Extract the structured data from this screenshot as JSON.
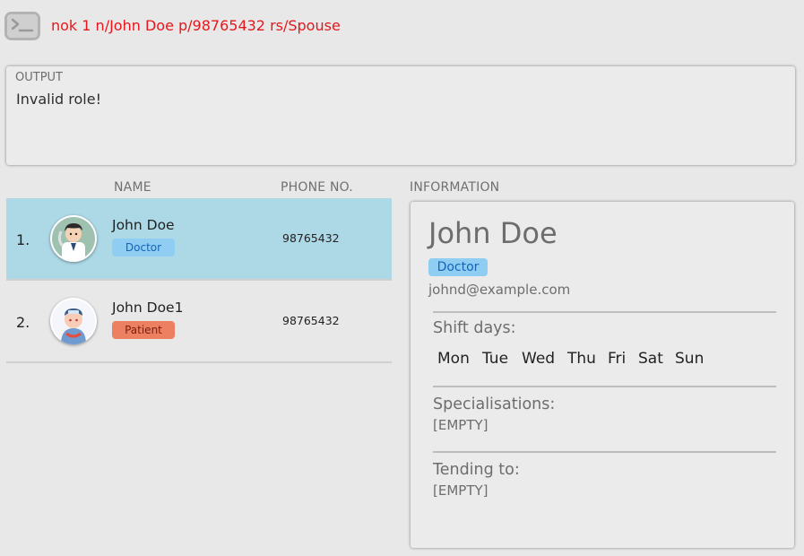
{
  "command": {
    "icon": "terminal-icon",
    "text": "nok 1 n/John Doe p/98765432 rs/Spouse",
    "text_color": "#e8161a"
  },
  "output": {
    "label": "OUTPUT",
    "message": "Invalid role!"
  },
  "list": {
    "headers": {
      "name": "NAME",
      "phone": "PHONE NO."
    },
    "rows": [
      {
        "index": "1.",
        "name": "John Doe",
        "role": "Doctor",
        "phone": "98765432",
        "avatar": "doctor-avatar-icon",
        "selected": true
      },
      {
        "index": "2.",
        "name": "John Doe1",
        "role": "Patient",
        "phone": "98765432",
        "avatar": "patient-avatar-icon",
        "selected": false
      }
    ]
  },
  "info": {
    "header": "INFORMATION",
    "name": "John Doe",
    "role": "Doctor",
    "email": "johnd@example.com",
    "shift_label": "Shift days:",
    "days": [
      "Mon",
      "Tue",
      "Wed",
      "Thu",
      "Fri",
      "Sat",
      "Sun"
    ],
    "specialisations_label": "Specialisations:",
    "specialisations": "[EMPTY]",
    "tending_label": "Tending to:",
    "tending": "[EMPTY]"
  },
  "colors": {
    "selected_row": "#add8e6",
    "doctor_tag": "#8fcdf3",
    "patient_tag": "#ec8060",
    "background": "#e8e8e8"
  }
}
